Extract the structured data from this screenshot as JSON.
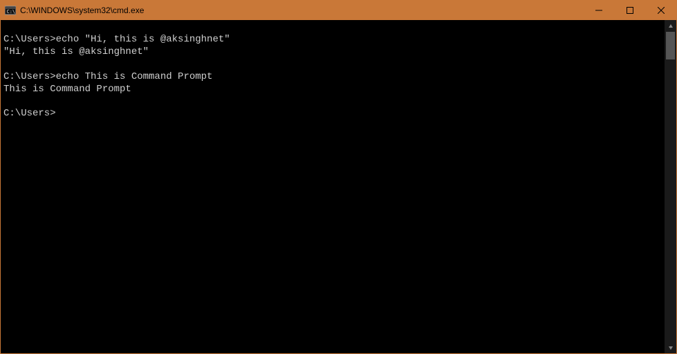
{
  "window": {
    "title": "C:\\WINDOWS\\system32\\cmd.exe"
  },
  "terminal": {
    "lines": [
      "",
      "C:\\Users>echo \"Hi, this is @aksinghnet\"",
      "\"Hi, this is @aksinghnet\"",
      "",
      "C:\\Users>echo This is Command Prompt",
      "This is Command Prompt",
      "",
      "C:\\Users>"
    ]
  }
}
